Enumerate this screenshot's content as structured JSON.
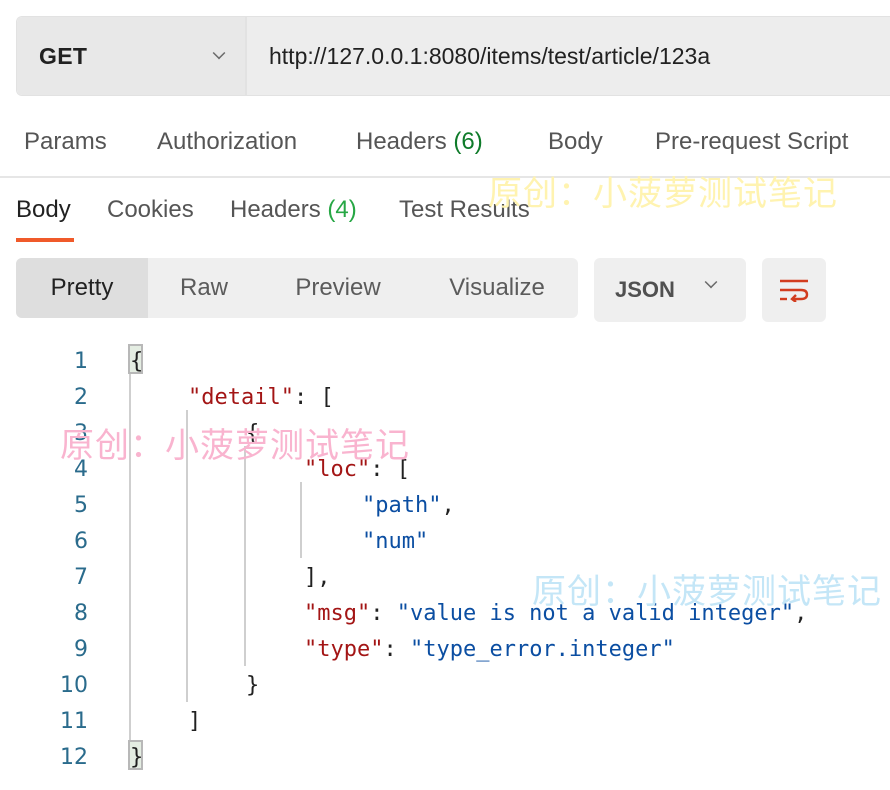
{
  "request": {
    "method": "GET",
    "url": "http://127.0.0.1:8080/items/test/article/123a"
  },
  "request_tabs": [
    {
      "label": "Params"
    },
    {
      "label": "Authorization"
    },
    {
      "label": "Headers",
      "count": "(6)"
    },
    {
      "label": "Body"
    },
    {
      "label": "Pre-request Script"
    }
  ],
  "response_tabs": [
    {
      "label": "Body",
      "active": true
    },
    {
      "label": "Cookies"
    },
    {
      "label": "Headers",
      "count": "(4)"
    },
    {
      "label": "Test Results"
    }
  ],
  "view_modes": [
    {
      "label": "Pretty",
      "active": true
    },
    {
      "label": "Raw"
    },
    {
      "label": "Preview"
    },
    {
      "label": "Visualize"
    }
  ],
  "format": {
    "selected": "JSON"
  },
  "wrap_icon": "wrap-lines-icon",
  "code": {
    "line_numbers": [
      "1",
      "2",
      "3",
      "4",
      "5",
      "6",
      "7",
      "8",
      "9",
      "10",
      "11",
      "12"
    ],
    "lines": [
      {
        "tokens": [
          {
            "t": "p",
            "v": "{"
          }
        ]
      },
      {
        "tokens": [
          {
            "t": "k",
            "v": "\"detail\""
          },
          {
            "t": "p",
            "v": ": ["
          }
        ]
      },
      {
        "tokens": [
          {
            "t": "p",
            "v": "{"
          }
        ]
      },
      {
        "tokens": [
          {
            "t": "k",
            "v": "\"loc\""
          },
          {
            "t": "p",
            "v": ": ["
          }
        ]
      },
      {
        "tokens": [
          {
            "t": "s",
            "v": "\"path\""
          },
          {
            "t": "p",
            "v": ","
          }
        ]
      },
      {
        "tokens": [
          {
            "t": "s",
            "v": "\"num\""
          }
        ]
      },
      {
        "tokens": [
          {
            "t": "p",
            "v": "],"
          }
        ]
      },
      {
        "tokens": [
          {
            "t": "k",
            "v": "\"msg\""
          },
          {
            "t": "p",
            "v": ": "
          },
          {
            "t": "s",
            "v": "\"value is not a valid integer\""
          },
          {
            "t": "p",
            "v": ","
          }
        ]
      },
      {
        "tokens": [
          {
            "t": "k",
            "v": "\"type\""
          },
          {
            "t": "p",
            "v": ": "
          },
          {
            "t": "s",
            "v": "\"type_error.integer\""
          }
        ]
      },
      {
        "tokens": [
          {
            "t": "p",
            "v": "}"
          }
        ]
      },
      {
        "tokens": [
          {
            "t": "p",
            "v": "]"
          }
        ]
      },
      {
        "tokens": [
          {
            "t": "p",
            "v": "}"
          }
        ]
      }
    ]
  },
  "watermarks": [
    {
      "text": "原创：小菠萝测试笔记",
      "color": "#fff3b0"
    },
    {
      "text": "原创：小菠萝测试笔记",
      "color": "#f9b4cf"
    },
    {
      "text": "原创：小菠萝测试笔记",
      "color": "#c4e6f7"
    }
  ],
  "colors": {
    "accent": "#f05a2a",
    "count_green_request": "#0f7b2a",
    "count_green_response": "#27a745",
    "json_key": "#a31515",
    "json_string": "#0b4ea2",
    "line_number": "#2a6b8c",
    "wrap_icon": "#d23c1e"
  }
}
